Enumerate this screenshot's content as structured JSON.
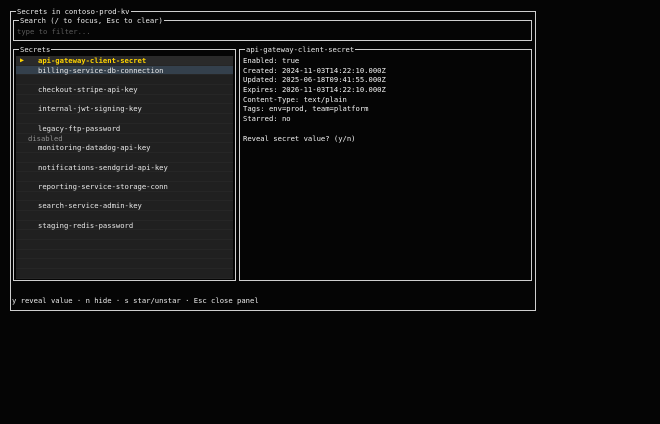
{
  "window": {
    "title": "Secrets in contoso-prod-kv"
  },
  "search": {
    "title": "Search (/ to focus, Esc to clear)",
    "placeholder": "type to filter...",
    "value": ""
  },
  "secrets": {
    "title": "Secrets",
    "selected_marker": "▶",
    "items": [
      {
        "name": "api-gateway-client-secret",
        "selected": true
      },
      {
        "name": "billing-service-db-connection"
      },
      {
        "name": ""
      },
      {
        "name": "checkout-stripe-api-key"
      },
      {
        "name": ""
      },
      {
        "name": "internal-jwt-signing-key"
      },
      {
        "name": ""
      },
      {
        "name": "legacy-ftp-password"
      },
      {
        "name": "",
        "sub": "disabled"
      },
      {
        "name": "monitoring-datadog-api-key"
      },
      {
        "name": ""
      },
      {
        "name": "notifications-sendgrid-api-key"
      },
      {
        "name": ""
      },
      {
        "name": "reporting-service-storage-conn"
      },
      {
        "name": ""
      },
      {
        "name": "search-service-admin-key"
      },
      {
        "name": ""
      },
      {
        "name": "staging-redis-password"
      },
      {
        "name": ""
      },
      {
        "name": ""
      },
      {
        "name": ""
      },
      {
        "name": ""
      },
      {
        "name": ""
      }
    ]
  },
  "detail": {
    "title": "api-gateway-client-secret",
    "lines": [
      "Enabled: true",
      "Created: 2024-11-03T14:22:10.000Z",
      "Updated: 2025-06-18T09:41:55.000Z",
      "Expires: 2026-11-03T14:22:10.000Z",
      "Content-Type: text/plain",
      "Tags: env=prod, team=platform",
      "Starred: no"
    ],
    "prompt": "Reveal secret value? (y/n)"
  },
  "footer": {
    "hint": "y reveal value · n hide · s star/unstar · Esc close panel"
  }
}
